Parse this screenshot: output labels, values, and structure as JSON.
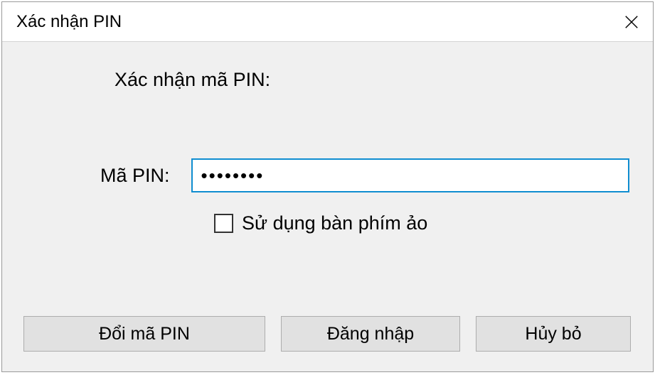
{
  "dialog": {
    "title": "Xác nhận PIN",
    "heading": "Xác nhận mã PIN:",
    "pin_label": "Mã PIN:",
    "pin_value": "••••••••",
    "checkbox_label": "Sử dụng bàn phím ảo",
    "buttons": {
      "change_pin": "Đổi mã PIN",
      "login": "Đăng nhập",
      "cancel": "Hủy bỏ"
    }
  }
}
